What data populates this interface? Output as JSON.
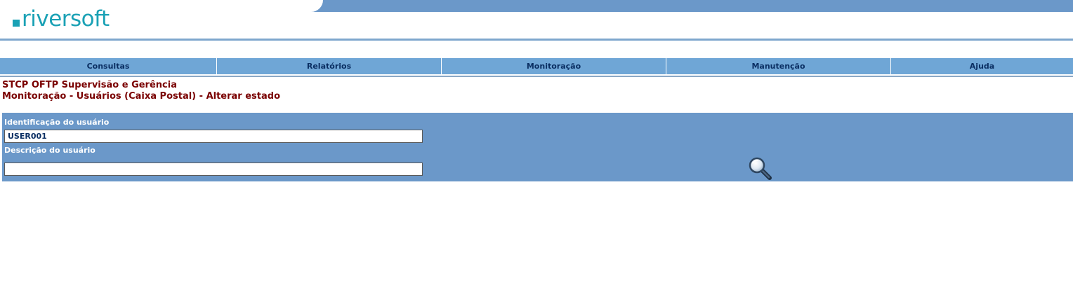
{
  "header": {
    "logo_text": "riversoft",
    "brand_color": "#1aa1b5",
    "bar_color": "#6b98c9"
  },
  "menu": {
    "items": [
      {
        "label": "Consultas"
      },
      {
        "label": "Relatórios"
      },
      {
        "label": "Monitoração"
      },
      {
        "label": "Manutenção"
      },
      {
        "label": "Ajuda"
      }
    ]
  },
  "titles": {
    "app": "STCP OFTP Supervisão e Gerência",
    "page": "Monitoração - Usuários (Caixa Postal) - Alterar estado"
  },
  "form": {
    "user_id_label": "Identificação do usuário",
    "user_id_value": "USER001",
    "user_desc_label": "Descrição do usuário",
    "user_desc_value": "",
    "search_icon": "magnifier-icon"
  }
}
